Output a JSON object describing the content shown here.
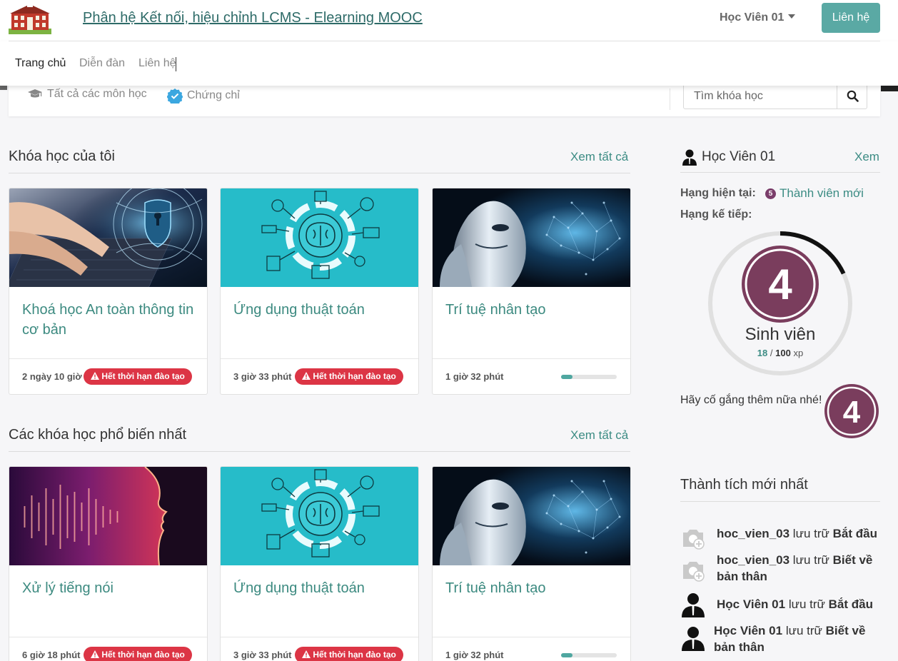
{
  "header": {
    "site_title": "Phân hệ Kết nối, hiệu chỉnh LCMS - Elearning MOOC",
    "user_name": "Học Viên 01",
    "contact_button": "Liên hệ"
  },
  "nav": {
    "items": [
      "Trang chủ",
      "Diễn đàn",
      "Liên hệ"
    ]
  },
  "filters": {
    "all_courses": "Tất cả các môn học",
    "certificates": "Chứng chỉ",
    "search_placeholder": "Tìm khóa học"
  },
  "my_courses": {
    "title": "Khóa học của tôi",
    "see_all": "Xem tất cả",
    "cards": [
      {
        "title": "Khoá học An toàn thông tin cơ bản",
        "duration": "2 ngày 10 giờ",
        "badge": "Hết thời hạn đào tạo",
        "image": "cyber-security-image"
      },
      {
        "title": "Ứng dụng thuật toán",
        "duration": "3 giờ 33 phút",
        "badge": "Hết thời hạn đào tạo",
        "image": "brain-algorithm-image"
      },
      {
        "title": "Trí tuệ nhân tạo",
        "duration": "1 giờ 32 phút",
        "progress": 0.2,
        "image": "robot-ai-image"
      }
    ]
  },
  "popular_courses": {
    "title": "Các khóa học phổ biến nhất",
    "see_all": "Xem tất cả",
    "cards": [
      {
        "title": "Xử lý tiếng nói",
        "duration": "6 giờ 18 phút",
        "badge": "Hết thời hạn đào tạo",
        "image": "speech-wave-image"
      },
      {
        "title": "Ứng dụng thuật toán",
        "duration": "3 giờ 33 phút",
        "badge": "Hết thời hạn đào tạo",
        "image": "brain-algorithm-image"
      },
      {
        "title": "Trí tuệ nhân tạo",
        "duration": "1 giờ 32 phút",
        "progress": 0.2,
        "image": "robot-ai-image"
      }
    ]
  },
  "sidebar": {
    "user_name": "Học Viên 01",
    "see": "Xem",
    "current_rank_label": "Hạng hiện tại:",
    "current_rank_value": "Thành viên mới",
    "current_rank_icon": "5",
    "next_rank_label": "Hạng kế tiếp:",
    "level_number": "4",
    "level_name": "Sinh viên",
    "xp_current": "18",
    "xp_separator": "/",
    "xp_max": "100",
    "xp_unit": "xp",
    "xp_progress": 0.18,
    "encourage": "Hãy cố gắng thêm nữa nhé!",
    "achievements_title": "Thành tích mới nhất",
    "achievements": [
      {
        "user": "hoc_vien_03",
        "action": "lưu trữ",
        "target": "Bắt đầu",
        "icon": "camera-plus-icon"
      },
      {
        "user": "hoc_vien_03",
        "action": "lưu trữ",
        "target": "Biết về bản thân",
        "icon": "camera-plus-icon"
      },
      {
        "user": "Học Viên 01",
        "action": "lưu trữ",
        "target": "Bắt đầu",
        "icon": "user-avatar-icon"
      },
      {
        "user": "Học Viên 01",
        "action": "lưu trữ",
        "target": "Biết về bản thân",
        "icon": "user-avatar-icon"
      }
    ]
  },
  "colors": {
    "accent": "#3c8c84",
    "button": "#5aa9a4",
    "danger": "#dc3545",
    "level_badge": "#7a3d6a"
  }
}
